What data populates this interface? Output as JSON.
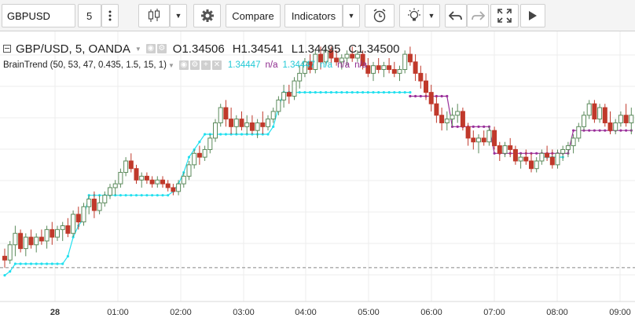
{
  "toolbar": {
    "symbol": "GBPUSD",
    "interval": "5",
    "compare_label": "Compare",
    "indicators_label": "Indicators"
  },
  "legend": {
    "title": "GBP/USD, 5, OANDA",
    "open_key": "O",
    "open": "1.34506",
    "high_key": "H",
    "high": "1.34541",
    "low_key": "L",
    "low": "1.34495",
    "close_key": "C",
    "close": "1.34500",
    "indicator": "BrainTrend (50, 53, 47, 0.435, 1.5, 15, 1)",
    "indicator_values": [
      {
        "text": "1.34447",
        "color": "#22c9d6"
      },
      {
        "text": "n/a",
        "color": "#8e2b8e"
      },
      {
        "text": "1.34447",
        "color": "#22c9d6"
      },
      {
        "text": "n/a",
        "color": "#22c9d6"
      },
      {
        "text": "n/a",
        "color": "#8e2b8e"
      },
      {
        "text": "n/a",
        "color": "#8e2b8e"
      }
    ]
  },
  "colors": {
    "up": "#5b8a5b",
    "down": "#c0392b",
    "cyan": "#22e0ef",
    "purple": "#9a2f9a",
    "grid": "#ececec"
  },
  "time_axis": {
    "labels": [
      "28",
      "01:00",
      "02:00",
      "03:00",
      "04:00",
      "05:00",
      "06:00",
      "07:00",
      "08:00",
      "09:00"
    ]
  },
  "chart_data": {
    "type": "candlestick",
    "bars_per_hour": 12,
    "x_labels": [
      "28",
      "01:00",
      "02:00",
      "03:00",
      "04:00",
      "05:00",
      "06:00",
      "07:00",
      "08:00",
      "09:00"
    ],
    "candles": [
      [
        1.3402,
        1.3404,
        1.3399,
        1.3401
      ],
      [
        1.3401,
        1.3406,
        1.34,
        1.3405
      ],
      [
        1.3405,
        1.341,
        1.3402,
        1.3408
      ],
      [
        1.3408,
        1.3409,
        1.3403,
        1.3404
      ],
      [
        1.3404,
        1.3408,
        1.3402,
        1.3407
      ],
      [
        1.3407,
        1.3409,
        1.3404,
        1.3405
      ],
      [
        1.3405,
        1.3408,
        1.3403,
        1.3407
      ],
      [
        1.3407,
        1.3409,
        1.3405,
        1.3406
      ],
      [
        1.3406,
        1.341,
        1.3404,
        1.3409
      ],
      [
        1.3409,
        1.3411,
        1.3405,
        1.3407
      ],
      [
        1.3407,
        1.341,
        1.3406,
        1.3409
      ],
      [
        1.3409,
        1.3411,
        1.3406,
        1.341
      ],
      [
        1.341,
        1.3412,
        1.3407,
        1.3408
      ],
      [
        1.3408,
        1.3414,
        1.3407,
        1.3413
      ],
      [
        1.3413,
        1.3415,
        1.3409,
        1.3411
      ],
      [
        1.3411,
        1.3416,
        1.341,
        1.3415
      ],
      [
        1.3415,
        1.3418,
        1.3413,
        1.3417
      ],
      [
        1.3417,
        1.3419,
        1.3412,
        1.3414
      ],
      [
        1.3414,
        1.3418,
        1.3413,
        1.3416
      ],
      [
        1.3416,
        1.3419,
        1.3415,
        1.3418
      ],
      [
        1.3418,
        1.3421,
        1.3417,
        1.342
      ],
      [
        1.342,
        1.3422,
        1.3418,
        1.3421
      ],
      [
        1.3421,
        1.3425,
        1.342,
        1.3424
      ],
      [
        1.3424,
        1.3428,
        1.3423,
        1.3427
      ],
      [
        1.3427,
        1.3429,
        1.3424,
        1.3425
      ],
      [
        1.3425,
        1.3426,
        1.3421,
        1.3422
      ],
      [
        1.3422,
        1.3424,
        1.342,
        1.3423
      ],
      [
        1.3423,
        1.3424,
        1.3421,
        1.3422
      ],
      [
        1.3422,
        1.3423,
        1.342,
        1.3421
      ],
      [
        1.3421,
        1.3423,
        1.342,
        1.3422
      ],
      [
        1.3422,
        1.3423,
        1.342,
        1.3421
      ],
      [
        1.3421,
        1.3422,
        1.3419,
        1.342
      ],
      [
        1.342,
        1.3421,
        1.3418,
        1.3419
      ],
      [
        1.3419,
        1.3422,
        1.3418,
        1.3421
      ],
      [
        1.3421,
        1.3424,
        1.342,
        1.3423
      ],
      [
        1.3423,
        1.3427,
        1.3422,
        1.3426
      ],
      [
        1.3426,
        1.343,
        1.3425,
        1.3429
      ],
      [
        1.3429,
        1.3431,
        1.3426,
        1.3428
      ],
      [
        1.3428,
        1.3431,
        1.3427,
        1.343
      ],
      [
        1.343,
        1.3434,
        1.3429,
        1.3433
      ],
      [
        1.3433,
        1.3438,
        1.3432,
        1.3437
      ],
      [
        1.3437,
        1.3442,
        1.3436,
        1.3441
      ],
      [
        1.3441,
        1.3443,
        1.3436,
        1.3438
      ],
      [
        1.3438,
        1.3441,
        1.3434,
        1.3436
      ],
      [
        1.3436,
        1.3439,
        1.3434,
        1.3438
      ],
      [
        1.3438,
        1.344,
        1.3435,
        1.3436
      ],
      [
        1.3436,
        1.3439,
        1.3434,
        1.3437
      ],
      [
        1.3437,
        1.3439,
        1.3434,
        1.3435
      ],
      [
        1.3435,
        1.3438,
        1.3433,
        1.3437
      ],
      [
        1.3437,
        1.344,
        1.3434,
        1.3436
      ],
      [
        1.3436,
        1.3439,
        1.3435,
        1.3438
      ],
      [
        1.3438,
        1.3441,
        1.3437,
        1.344
      ],
      [
        1.344,
        1.3444,
        1.3439,
        1.3443
      ],
      [
        1.3443,
        1.3447,
        1.3441,
        1.3445
      ],
      [
        1.3445,
        1.3447,
        1.3442,
        1.3444
      ],
      [
        1.3444,
        1.3449,
        1.3443,
        1.3448
      ],
      [
        1.3448,
        1.3452,
        1.3446,
        1.345
      ],
      [
        1.345,
        1.3454,
        1.3449,
        1.3453
      ],
      [
        1.3453,
        1.3455,
        1.345,
        1.3451
      ],
      [
        1.3451,
        1.3456,
        1.345,
        1.3455
      ],
      [
        1.3455,
        1.3457,
        1.3451,
        1.3453
      ],
      [
        1.3453,
        1.3457,
        1.3452,
        1.3456
      ],
      [
        1.3456,
        1.3457,
        1.3452,
        1.3454
      ],
      [
        1.3454,
        1.3456,
        1.3452,
        1.3453
      ],
      [
        1.3453,
        1.3455,
        1.3451,
        1.3454
      ],
      [
        1.3454,
        1.3456,
        1.3452,
        1.3455
      ],
      [
        1.3455,
        1.3457,
        1.3453,
        1.3454
      ],
      [
        1.3454,
        1.3456,
        1.3453,
        1.3455
      ],
      [
        1.3455,
        1.3456,
        1.3451,
        1.3452
      ],
      [
        1.3452,
        1.3454,
        1.3449,
        1.345
      ],
      [
        1.345,
        1.3453,
        1.3448,
        1.3452
      ],
      [
        1.3452,
        1.3454,
        1.345,
        1.3451
      ],
      [
        1.3451,
        1.3453,
        1.3449,
        1.3452
      ],
      [
        1.3452,
        1.3454,
        1.345,
        1.3451
      ],
      [
        1.3451,
        1.3453,
        1.3449,
        1.345
      ],
      [
        1.345,
        1.3452,
        1.3448,
        1.3451
      ],
      [
        1.3451,
        1.3456,
        1.345,
        1.3455
      ],
      [
        1.3455,
        1.3457,
        1.3452,
        1.3453
      ],
      [
        1.3453,
        1.3455,
        1.3448,
        1.345
      ],
      [
        1.345,
        1.3452,
        1.3446,
        1.3448
      ],
      [
        1.3448,
        1.345,
        1.3443,
        1.3445
      ],
      [
        1.3445,
        1.3447,
        1.344,
        1.3442
      ],
      [
        1.3442,
        1.3444,
        1.3437,
        1.3439
      ],
      [
        1.3439,
        1.3441,
        1.3435,
        1.3437
      ],
      [
        1.3437,
        1.344,
        1.3435,
        1.3438
      ],
      [
        1.3438,
        1.3441,
        1.3436,
        1.3439
      ],
      [
        1.3439,
        1.3442,
        1.3437,
        1.344
      ],
      [
        1.344,
        1.3441,
        1.3435,
        1.3436
      ],
      [
        1.3436,
        1.3437,
        1.3431,
        1.3433
      ],
      [
        1.3433,
        1.3435,
        1.343,
        1.3432
      ],
      [
        1.3432,
        1.3434,
        1.3429,
        1.3433
      ],
      [
        1.3433,
        1.3435,
        1.3431,
        1.3432
      ],
      [
        1.3432,
        1.3436,
        1.3431,
        1.3435
      ],
      [
        1.3435,
        1.3436,
        1.343,
        1.3431
      ],
      [
        1.3431,
        1.3432,
        1.3427,
        1.3429
      ],
      [
        1.3429,
        1.3432,
        1.3428,
        1.3431
      ],
      [
        1.3431,
        1.3433,
        1.3428,
        1.343
      ],
      [
        1.343,
        1.3431,
        1.3426,
        1.3427
      ],
      [
        1.3427,
        1.3429,
        1.3425,
        1.3428
      ],
      [
        1.3428,
        1.343,
        1.3426,
        1.3427
      ],
      [
        1.3427,
        1.3429,
        1.3424,
        1.3425
      ],
      [
        1.3425,
        1.3428,
        1.3424,
        1.3427
      ],
      [
        1.3427,
        1.343,
        1.3426,
        1.3429
      ],
      [
        1.3429,
        1.3431,
        1.3427,
        1.3428
      ],
      [
        1.3428,
        1.343,
        1.3425,
        1.3426
      ],
      [
        1.3426,
        1.343,
        1.3425,
        1.3429
      ],
      [
        1.3429,
        1.3431,
        1.3427,
        1.343
      ],
      [
        1.343,
        1.3432,
        1.3428,
        1.3431
      ],
      [
        1.3431,
        1.3434,
        1.3429,
        1.3433
      ],
      [
        1.3433,
        1.3437,
        1.3432,
        1.3436
      ],
      [
        1.3436,
        1.344,
        1.3435,
        1.3439
      ],
      [
        1.3439,
        1.3443,
        1.3438,
        1.3442
      ],
      [
        1.3442,
        1.3443,
        1.3437,
        1.3438
      ],
      [
        1.3438,
        1.3442,
        1.3437,
        1.3441
      ],
      [
        1.3441,
        1.3442,
        1.3436,
        1.3437
      ],
      [
        1.3437,
        1.344,
        1.3434,
        1.3435
      ],
      [
        1.3435,
        1.3438,
        1.3434,
        1.3437
      ],
      [
        1.3437,
        1.344,
        1.3436,
        1.3439
      ],
      [
        1.3439,
        1.3442,
        1.3436,
        1.3437
      ],
      [
        1.3437,
        1.3441,
        1.3434,
        1.3439
      ]
    ],
    "supertrend_up": [
      [
        0,
        1.3397
      ],
      [
        1,
        1.3398
      ],
      [
        2,
        1.34
      ],
      [
        3,
        1.34
      ],
      [
        4,
        1.34
      ],
      [
        5,
        1.34
      ],
      [
        6,
        1.34
      ],
      [
        7,
        1.34
      ],
      [
        8,
        1.34
      ],
      [
        9,
        1.34
      ],
      [
        10,
        1.34
      ],
      [
        11,
        1.34
      ],
      [
        12,
        1.3402
      ],
      [
        13,
        1.3407
      ],
      [
        14,
        1.341
      ],
      [
        15,
        1.3412
      ],
      [
        16,
        1.3418
      ],
      [
        17,
        1.3418
      ],
      [
        18,
        1.3418
      ],
      [
        19,
        1.3418
      ],
      [
        20,
        1.3418
      ],
      [
        21,
        1.3418
      ],
      [
        22,
        1.3418
      ],
      [
        23,
        1.3418
      ],
      [
        24,
        1.3418
      ],
      [
        25,
        1.3418
      ],
      [
        26,
        1.3418
      ],
      [
        27,
        1.3418
      ],
      [
        28,
        1.3418
      ],
      [
        29,
        1.3418
      ],
      [
        30,
        1.3418
      ],
      [
        31,
        1.3418
      ],
      [
        32,
        1.3419
      ],
      [
        33,
        1.3421
      ],
      [
        34,
        1.3424
      ],
      [
        35,
        1.3428
      ],
      [
        36,
        1.343
      ],
      [
        37,
        1.3432
      ],
      [
        38,
        1.3434
      ],
      [
        39,
        1.3434
      ],
      [
        40,
        1.3434
      ],
      [
        41,
        1.3434
      ],
      [
        42,
        1.3434
      ],
      [
        43,
        1.3434
      ],
      [
        44,
        1.3434
      ],
      [
        45,
        1.3434
      ],
      [
        46,
        1.3434
      ],
      [
        47,
        1.3434
      ],
      [
        48,
        1.3434
      ],
      [
        49,
        1.3434
      ],
      [
        50,
        1.3434
      ],
      [
        51,
        1.3436
      ],
      [
        52,
        1.3441
      ],
      [
        53,
        1.3445
      ],
      [
        54,
        1.3445
      ],
      [
        55,
        1.3445
      ],
      [
        56,
        1.3445
      ],
      [
        57,
        1.3445
      ],
      [
        58,
        1.3445
      ],
      [
        59,
        1.3445
      ],
      [
        60,
        1.3445
      ],
      [
        61,
        1.3445
      ],
      [
        62,
        1.3445
      ],
      [
        63,
        1.3445
      ],
      [
        64,
        1.3445
      ],
      [
        65,
        1.3445
      ],
      [
        66,
        1.3445
      ],
      [
        67,
        1.3445
      ],
      [
        68,
        1.3445
      ],
      [
        69,
        1.3445
      ],
      [
        70,
        1.3445
      ],
      [
        71,
        1.3445
      ],
      [
        72,
        1.3445
      ],
      [
        73,
        1.3445
      ],
      [
        74,
        1.3445
      ],
      [
        75,
        1.3445
      ],
      [
        76,
        1.3445
      ],
      [
        77,
        1.3445
      ]
    ],
    "supertrend_down": [
      [
        77,
        1.3444
      ],
      [
        78,
        1.3444
      ],
      [
        79,
        1.3444
      ],
      [
        80,
        1.3444
      ],
      [
        81,
        1.3444
      ],
      [
        82,
        1.3444
      ],
      [
        83,
        1.3444
      ],
      [
        84,
        1.3444
      ],
      [
        85,
        1.3436
      ],
      [
        86,
        1.3436
      ],
      [
        87,
        1.3436
      ],
      [
        88,
        1.3436
      ],
      [
        89,
        1.3436
      ],
      [
        90,
        1.3436
      ],
      [
        91,
        1.3436
      ],
      [
        92,
        1.3436
      ],
      [
        93,
        1.3429
      ],
      [
        94,
        1.3429
      ],
      [
        95,
        1.3429
      ],
      [
        96,
        1.3429
      ],
      [
        97,
        1.3429
      ],
      [
        98,
        1.3429
      ],
      [
        99,
        1.3429
      ],
      [
        100,
        1.3429
      ],
      [
        101,
        1.3429
      ],
      [
        102,
        1.3429
      ],
      [
        103,
        1.3429
      ],
      [
        104,
        1.3429
      ],
      [
        105,
        1.3429
      ],
      [
        106,
        1.3429
      ],
      [
        107,
        1.3429
      ],
      [
        108,
        1.3435
      ],
      [
        109,
        1.3435
      ],
      [
        110,
        1.3435
      ],
      [
        111,
        1.3435
      ],
      [
        112,
        1.3435
      ],
      [
        113,
        1.3435
      ],
      [
        114,
        1.3435
      ],
      [
        115,
        1.3435
      ],
      [
        116,
        1.3435
      ],
      [
        117,
        1.3435
      ],
      [
        118,
        1.3435
      ],
      [
        119,
        1.3435
      ]
    ],
    "supertrend_up_tail": [
      [
        102,
        1.3428
      ],
      [
        103,
        1.3428
      ],
      [
        104,
        1.3428
      ],
      [
        105,
        1.3428
      ],
      [
        106,
        1.3428
      ]
    ],
    "baseline": 1.3399,
    "ylim": [
      1.3393,
      1.3461
    ]
  }
}
